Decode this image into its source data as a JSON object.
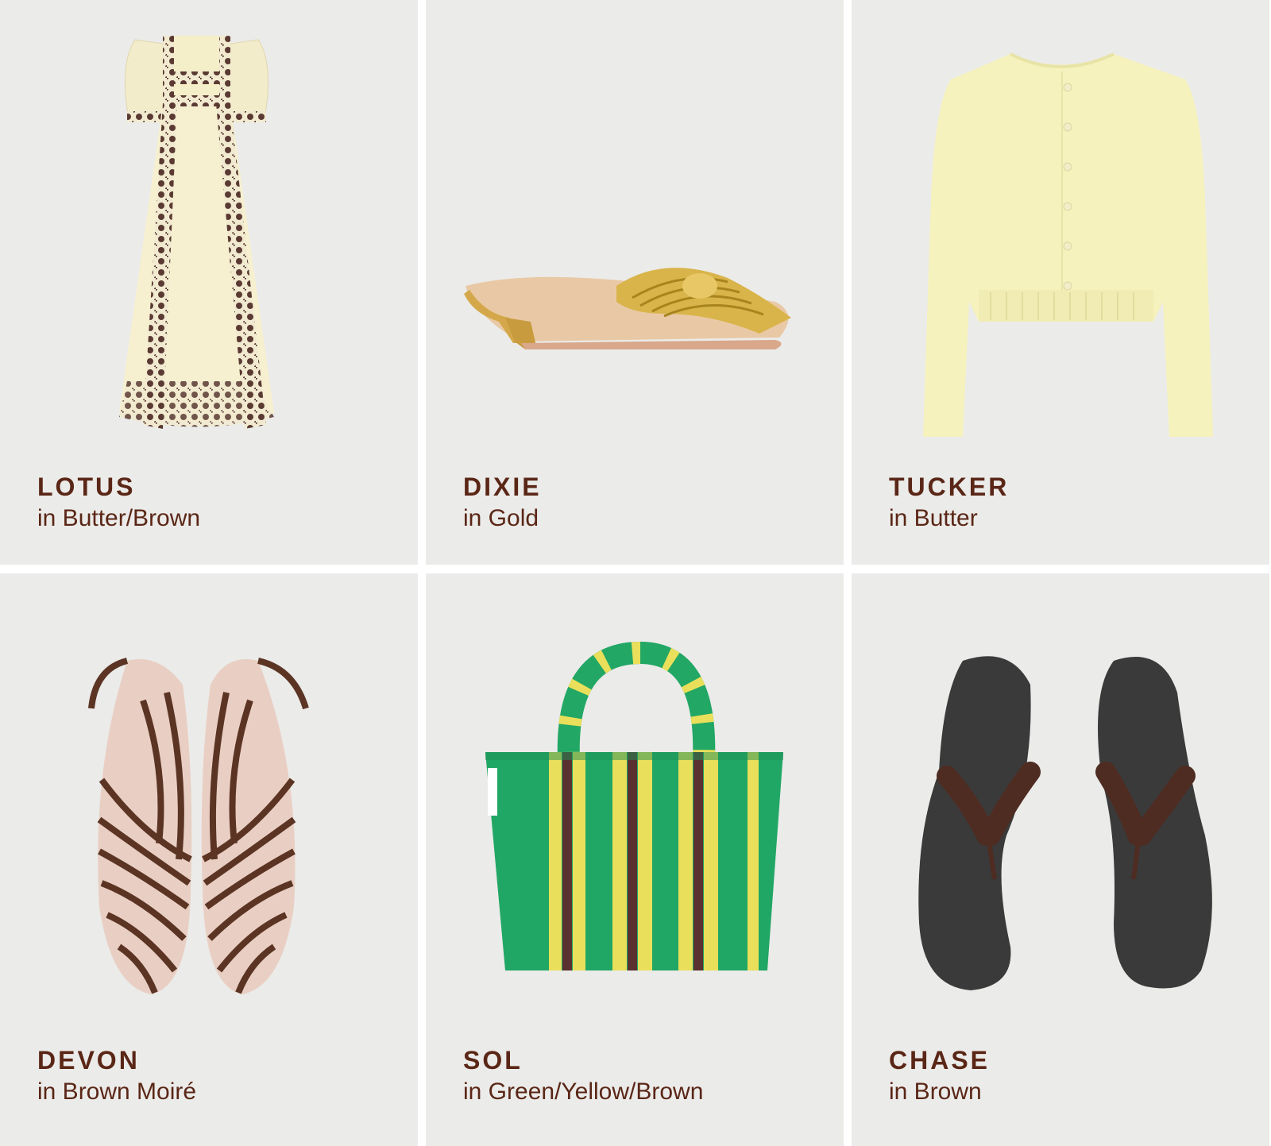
{
  "products": [
    {
      "name": "LOTUS",
      "color": "in Butter/Brown"
    },
    {
      "name": "DIXIE",
      "color": "in Gold"
    },
    {
      "name": "TUCKER",
      "color": "in Butter"
    },
    {
      "name": "DEVON",
      "color": "in Brown Moiré"
    },
    {
      "name": "SOL",
      "color": "in Green/Yellow/Brown"
    },
    {
      "name": "CHASE",
      "color": "in Brown"
    }
  ],
  "palette": {
    "background": "#ebebe9",
    "text": "#5a2616",
    "butter": "#f5f0c4",
    "gold": "#d9b44a",
    "brown": "#4e2c22",
    "green": "#21a765",
    "yellow": "#e9df5a",
    "black": "#3a3a3a"
  }
}
